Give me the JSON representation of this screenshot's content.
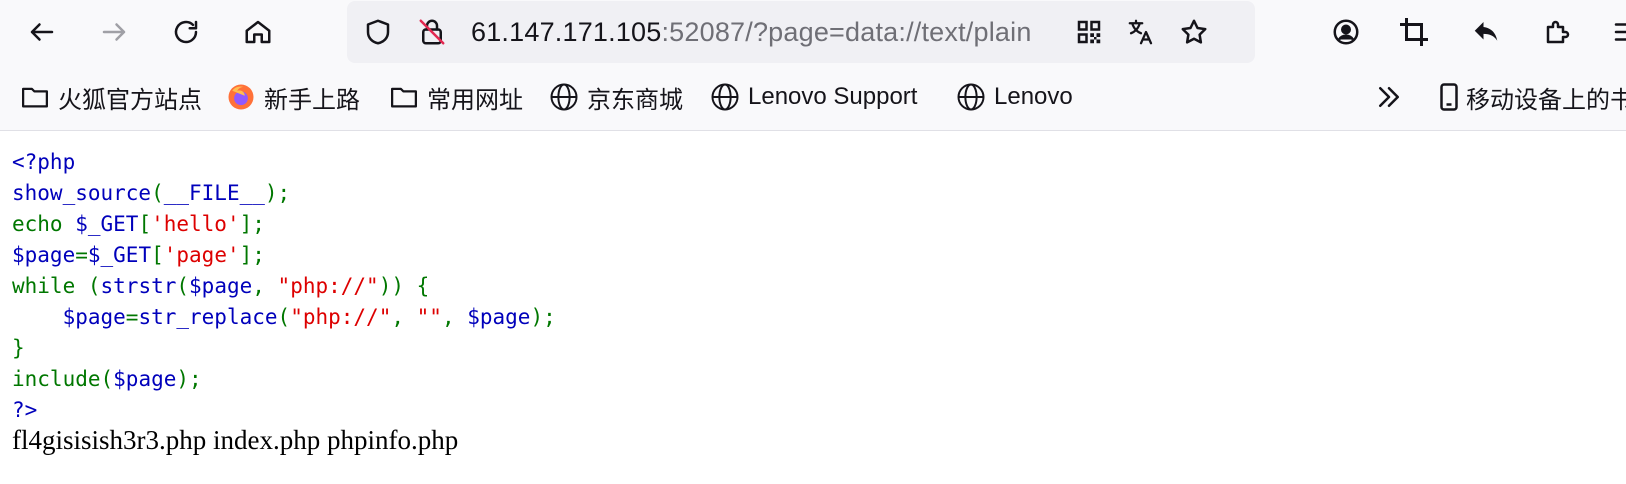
{
  "url": {
    "host": "61.147.171.105",
    "rest": ":52087/?page=data://text/plain"
  },
  "bookmarks": [
    {
      "label": "火狐官方站点",
      "icon": "folder-icon"
    },
    {
      "label": "新手上路",
      "icon": "firefox-icon"
    },
    {
      "label": "常用网址",
      "icon": "folder-icon"
    },
    {
      "label": "京东商城",
      "icon": "globe-icon"
    },
    {
      "label": "Lenovo Support",
      "icon": "globe-icon"
    },
    {
      "label": "Lenovo",
      "icon": "globe-icon"
    }
  ],
  "mobile_bookmarks": "移动设备上的书",
  "source": {
    "l1": "<?php",
    "l2_fn": "show_source",
    "l2_p1": "(",
    "l2_const": "__FILE__",
    "l2_p2": ");",
    "l3_kw": "echo ",
    "l3_var": "$_GET",
    "l3_b1": "[",
    "l3_str": "'hello'",
    "l3_b2": "];",
    "l4_var": "$page",
    "l4_eq": "=",
    "l4_var2": "$_GET",
    "l4_b1": "[",
    "l4_str": "'page'",
    "l4_b2": "];",
    "l5_kw": "while (",
    "l5_fn": "strstr",
    "l5_p1": "(",
    "l5_var": "$page",
    "l5_c": ", ",
    "l5_str": "\"php://\"",
    "l5_p2": ")) {",
    "l6_indent": "    ",
    "l6_var": "$page",
    "l6_eq": "=",
    "l6_fn": "str_replace",
    "l6_p1": "(",
    "l6_s1": "\"php://\"",
    "l6_c1": ", ",
    "l6_s2": "\"\"",
    "l6_c2": ", ",
    "l6_var2": "$page",
    "l6_p2": ");",
    "l7": "}",
    "l8_kw": "include(",
    "l8_var": "$page",
    "l8_p": ");",
    "l9": "?>"
  },
  "output_text": "fl4gisisish3r3.php index.php phpinfo.php"
}
